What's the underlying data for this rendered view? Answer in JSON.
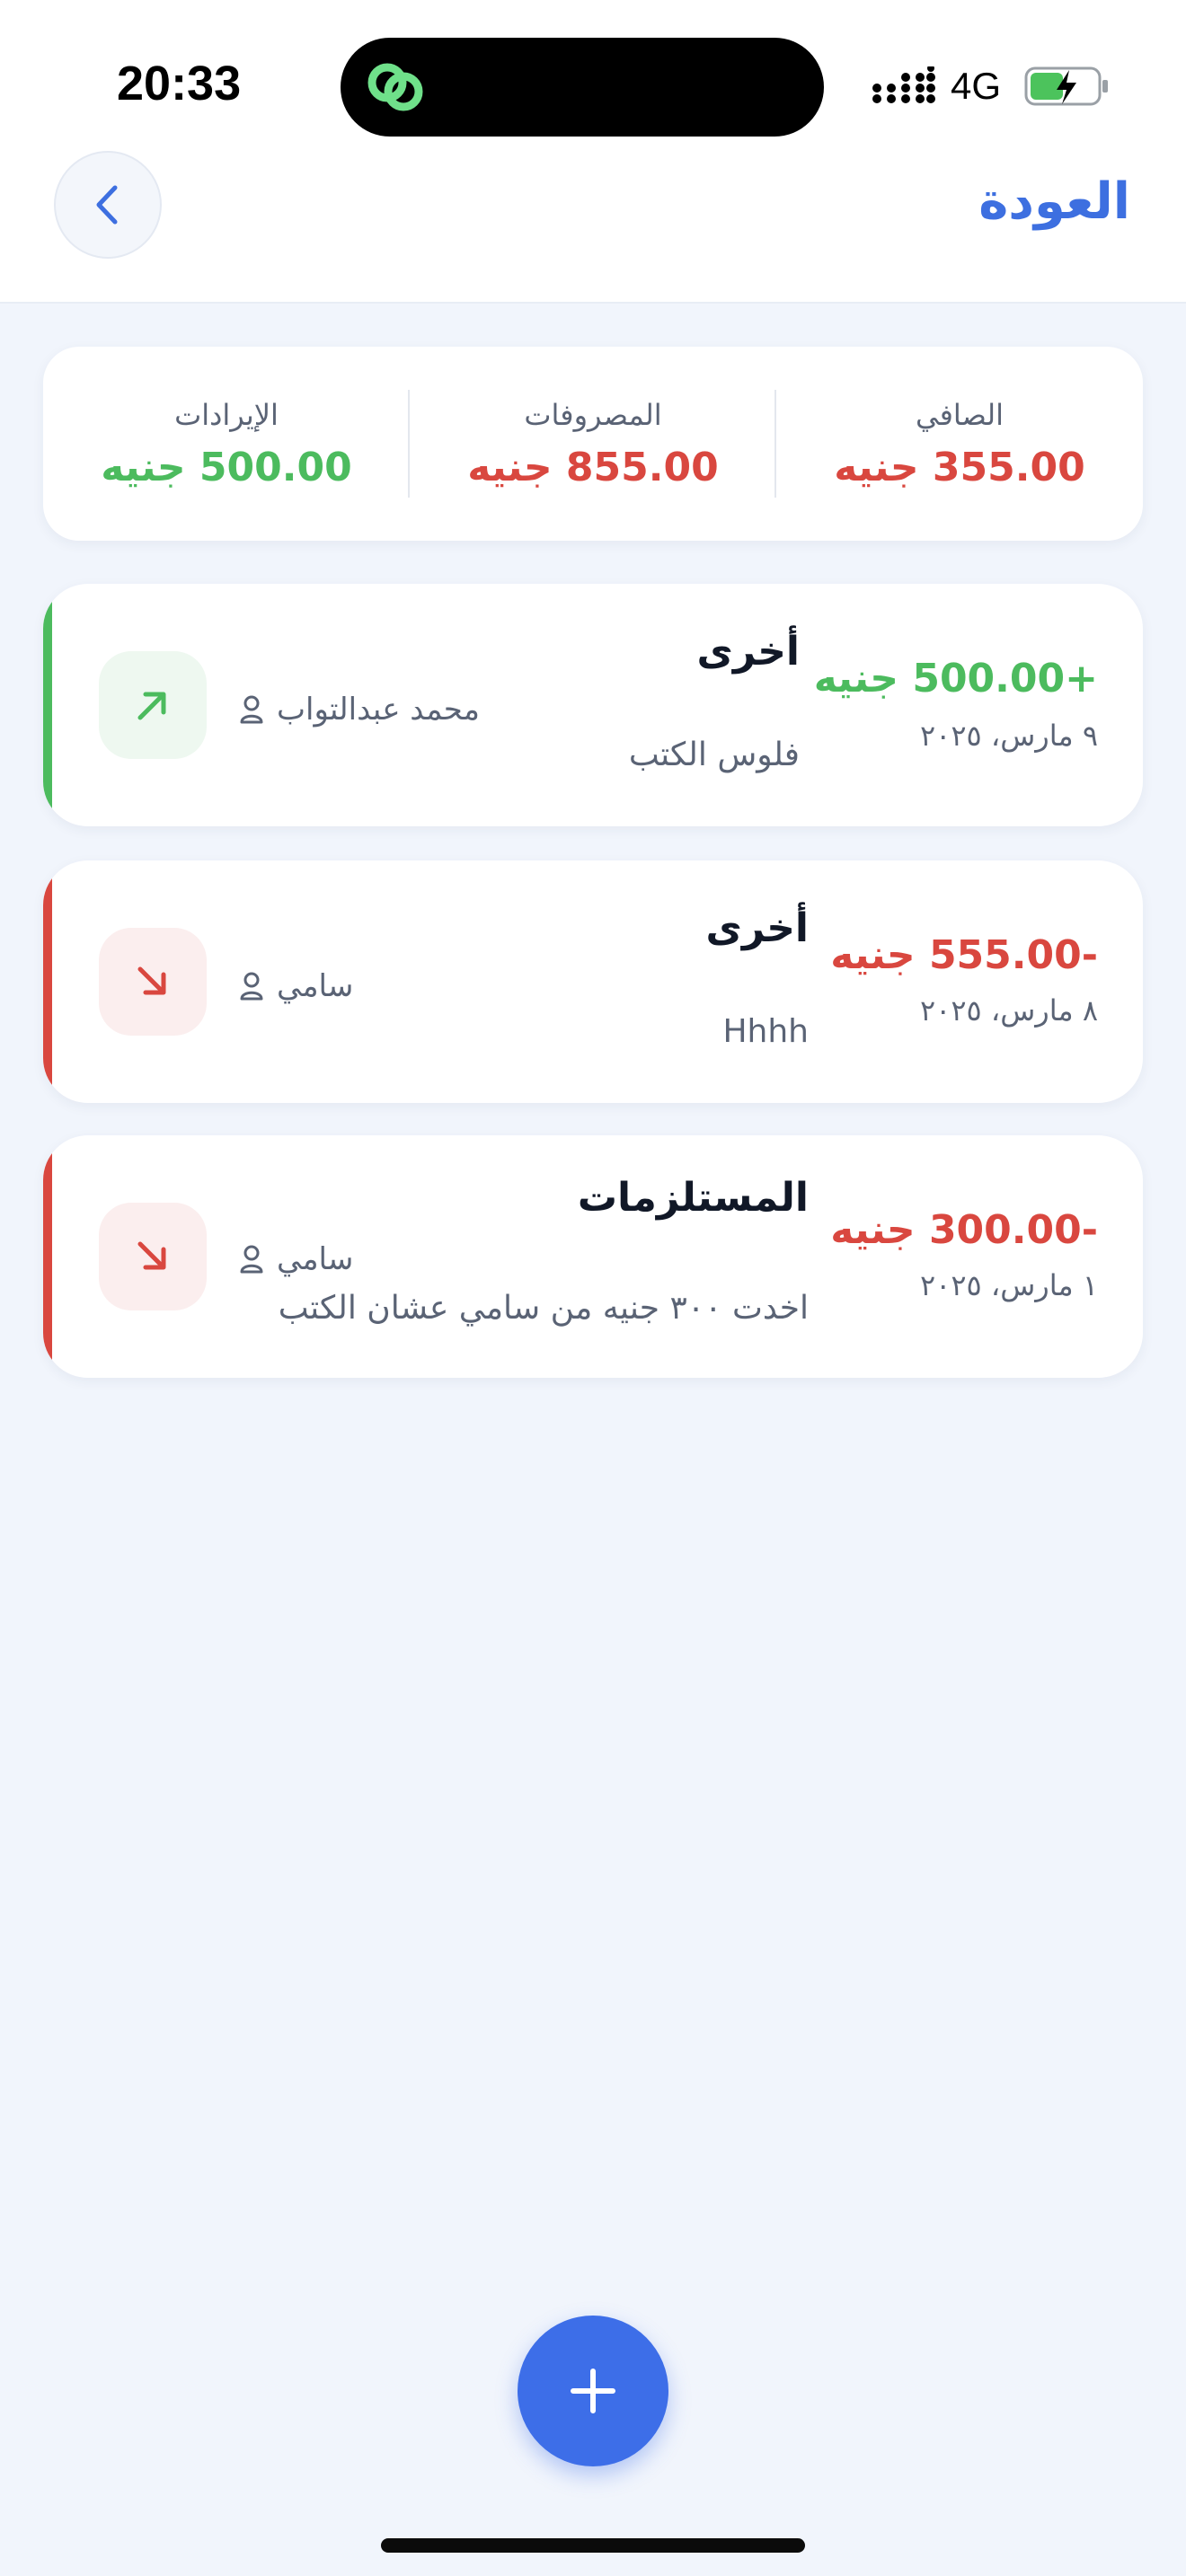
{
  "status_bar": {
    "time": "20:33",
    "network": "4G"
  },
  "header": {
    "back_label": "العودة"
  },
  "summary": {
    "net_label": "الصافي",
    "net_value": "355.00 جنيه",
    "expenses_label": "المصروفات",
    "expenses_value": "855.00 جنيه",
    "income_label": "الإيرادات",
    "income_value": "500.00 جنيه"
  },
  "transactions": [
    {
      "type": "income",
      "amount": "+500.00 جنيه",
      "date": "٩ مارس، ٢٠٢٥",
      "category": "أخرى",
      "person": "محمد عبدالتواب",
      "note": "فلوس الكتب"
    },
    {
      "type": "expense",
      "amount": "-555.00 جنيه",
      "date": "٨ مارس، ٢٠٢٥",
      "category": "أخرى",
      "person": "سامي",
      "note": "Hhhh"
    },
    {
      "type": "expense",
      "amount": "-300.00 جنيه",
      "date": "١ مارس، ٢٠٢٥",
      "category": "المستلزمات",
      "person": "سامي",
      "note": "اخدت ٣٠٠ جنيه من سامي عشان الكتب"
    }
  ],
  "colors": {
    "accent": "#3d6fe0",
    "income": "#4cbb5e",
    "expense": "#d9473f",
    "income_bg": "#eef8f0",
    "expense_bg": "#fbeeee"
  },
  "icons": {
    "back": "chevron-left-icon",
    "income": "arrow-up-right-icon",
    "expense": "arrow-down-right-icon",
    "person": "user-icon",
    "add": "plus-icon"
  }
}
